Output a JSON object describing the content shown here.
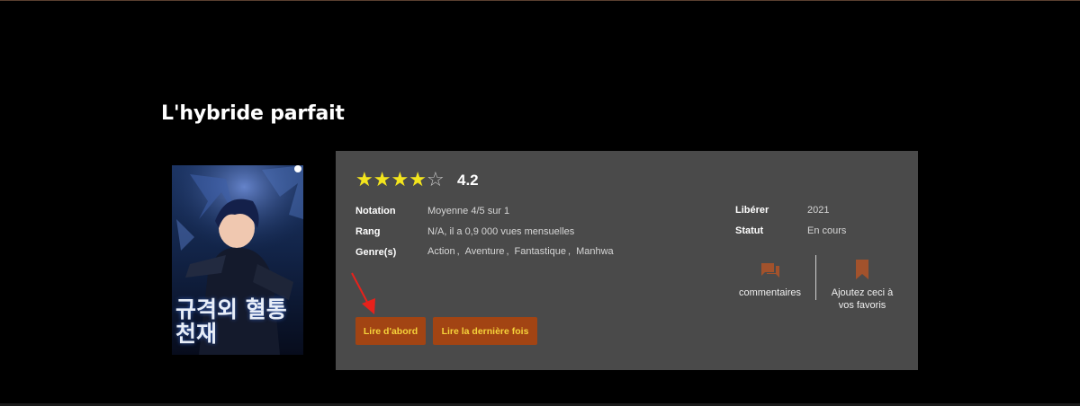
{
  "manga": {
    "title": "L'hybride parfait",
    "cover_text": "규격외 혈통천재",
    "rating": {
      "stars_filled": 4,
      "stars_total": 5,
      "score": "4.2"
    },
    "details": {
      "notation_label": "Notation",
      "notation_prefix": "Moyenne",
      "notation_value": "4/5",
      "notation_sur": "sur",
      "notation_max": "1",
      "rang_label": "Rang",
      "rang_value": "N/A, il a 0,9 000 vues mensuelles",
      "genre_label": "Genre(s)",
      "genres": [
        "Action",
        "Aventure",
        "Fantastique",
        "Manhwa"
      ],
      "genre_separator": ",",
      "liberer_label": "Libérer",
      "liberer_value": "2021",
      "statut_label": "Statut",
      "statut_value": "En cours"
    },
    "actions": {
      "comments_label": "commentaires",
      "favorites_label_line1": "Ajoutez ceci à",
      "favorites_label_line2": "vos favoris"
    },
    "buttons": {
      "read_first": "Lire d'abord",
      "read_last": "Lire la dernière fois"
    }
  },
  "colors": {
    "background": "#000000",
    "card": "#4a4a4a",
    "star": "#f3e51d",
    "button_bg": "#a24413",
    "button_text": "#f6d33a",
    "icon": "#a2522c",
    "annotation_arrow": "#e8211b"
  }
}
